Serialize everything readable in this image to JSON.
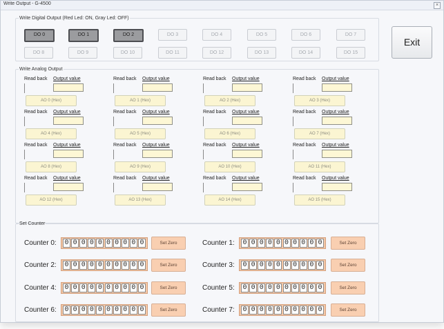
{
  "window": {
    "title": "Write Output - G-4500",
    "close_icon": "close-icon"
  },
  "digital_output": {
    "legend": "Write Digital Output  (Red Led: ON, Gray Led: OFF)",
    "items": [
      {
        "label": "DO 0",
        "on": true
      },
      {
        "label": "DO 1",
        "on": true
      },
      {
        "label": "DO 2",
        "on": true
      },
      {
        "label": "DO 3",
        "on": false
      },
      {
        "label": "DO 4",
        "on": false
      },
      {
        "label": "DO 5",
        "on": false
      },
      {
        "label": "DO 6",
        "on": false
      },
      {
        "label": "DO 7",
        "on": false
      },
      {
        "label": "DO 8",
        "on": false
      },
      {
        "label": "DO 9",
        "on": false
      },
      {
        "label": "DO 10",
        "on": false
      },
      {
        "label": "DO 11",
        "on": false
      },
      {
        "label": "DO 12",
        "on": false
      },
      {
        "label": "DO 13",
        "on": false
      },
      {
        "label": "DO 14",
        "on": false
      },
      {
        "label": "DO 15",
        "on": false
      }
    ]
  },
  "exit_label": "Exit",
  "analog_output": {
    "legend": "Write Analog Output",
    "read_back_label": "Read back",
    "output_value_label": "Output value",
    "items": [
      {
        "button": "AO 0 (Hex)",
        "value": ""
      },
      {
        "button": "AO 1 (Hex)",
        "value": ""
      },
      {
        "button": "AO 2 (Hex)",
        "value": ""
      },
      {
        "button": "AO 3 (Hex)",
        "value": ""
      },
      {
        "button": "AO 4 (Hex)",
        "value": ""
      },
      {
        "button": "AO 5 (Hex)",
        "value": ""
      },
      {
        "button": "AO 6 (Hex)",
        "value": ""
      },
      {
        "button": "AO 7 (Hex)",
        "value": ""
      },
      {
        "button": "AO 8 (Hex)",
        "value": ""
      },
      {
        "button": "AO 9 (Hex)",
        "value": ""
      },
      {
        "button": "AO 10 (Hex)",
        "value": ""
      },
      {
        "button": "AO 11 (Hex)",
        "value": ""
      },
      {
        "button": "AO 12 (Hex)",
        "value": ""
      },
      {
        "button": "AO 13 (Hex)",
        "value": ""
      },
      {
        "button": "AO 14 (Hex)",
        "value": ""
      },
      {
        "button": "AO 15 (Hex)",
        "value": ""
      }
    ]
  },
  "counters": {
    "legend": "Set Counter",
    "set_zero_label": "Set Zero",
    "items": [
      {
        "label": "Counter 0:",
        "digits": [
          "0",
          "0",
          "0",
          "0",
          "0",
          "0",
          "0",
          "0",
          "0",
          "0"
        ]
      },
      {
        "label": "Counter 1:",
        "digits": [
          "0",
          "0",
          "0",
          "0",
          "0",
          "0",
          "0",
          "0",
          "0",
          "0"
        ]
      },
      {
        "label": "Counter 2:",
        "digits": [
          "0",
          "0",
          "0",
          "0",
          "0",
          "0",
          "0",
          "0",
          "0",
          "0"
        ]
      },
      {
        "label": "Counter 3:",
        "digits": [
          "0",
          "0",
          "0",
          "0",
          "0",
          "0",
          "0",
          "0",
          "0",
          "0"
        ]
      },
      {
        "label": "Counter 4:",
        "digits": [
          "0",
          "0",
          "0",
          "0",
          "0",
          "0",
          "0",
          "0",
          "0",
          "0"
        ]
      },
      {
        "label": "Counter 5:",
        "digits": [
          "0",
          "0",
          "0",
          "0",
          "0",
          "0",
          "0",
          "0",
          "0",
          "0"
        ]
      },
      {
        "label": "Counter 6:",
        "digits": [
          "0",
          "0",
          "0",
          "0",
          "0",
          "0",
          "0",
          "0",
          "0",
          "0"
        ]
      },
      {
        "label": "Counter 7:",
        "digits": [
          "0",
          "0",
          "0",
          "0",
          "0",
          "0",
          "0",
          "0",
          "0",
          "0"
        ]
      }
    ]
  }
}
